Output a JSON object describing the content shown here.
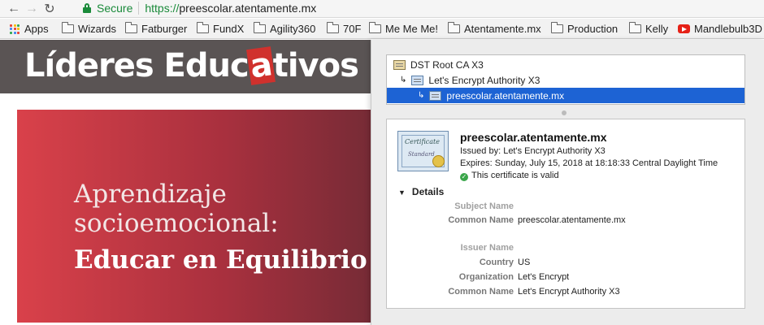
{
  "browser": {
    "secure_label": "Secure",
    "url_scheme": "https://",
    "url_rest": "preescolar.atentamente.mx",
    "bookmarks": [
      {
        "label": "Apps",
        "icon": "apps-grid-icon"
      },
      {
        "label": "Wizards",
        "icon": "folder-icon"
      },
      {
        "label": "Fatburger",
        "icon": "folder-icon"
      },
      {
        "label": "FundX",
        "icon": "folder-icon"
      },
      {
        "label": "Agility360",
        "icon": "folder-icon"
      },
      {
        "label": "70F",
        "icon": "folder-icon"
      },
      {
        "label": "Me Me Me!",
        "icon": "folder-icon"
      },
      {
        "label": "Atentamente.mx",
        "icon": "folder-icon"
      },
      {
        "label": "Production",
        "icon": "folder-icon"
      },
      {
        "label": "Kelly",
        "icon": "folder-icon"
      },
      {
        "label": "Mandlebulb3D",
        "icon": "youtube-icon"
      }
    ]
  },
  "site": {
    "logo_part1": "Líderes Educ",
    "logo_part2": "a",
    "logo_part3": "tivos",
    "hero_line1": "Aprendizaje",
    "hero_line2": "socioemocional:",
    "hero_line3": "Educar en Equilibrio"
  },
  "certificate": {
    "chain": [
      {
        "label": "DST Root CA X3"
      },
      {
        "label": "Let's Encrypt Authority X3"
      },
      {
        "label": "preescolar.atentamente.mx"
      }
    ],
    "badge_text1": "Certificate",
    "badge_text2": "Standard",
    "title": "preescolar.atentamente.mx",
    "issued_by": "Issued by: Let's Encrypt Authority X3",
    "expires": "Expires: Sunday, July 15, 2018 at 18:18:33 Central Daylight Time",
    "valid": "This certificate is valid",
    "details_label": "Details",
    "subject_section": "Subject Name",
    "subject_common_name_label": "Common Name",
    "subject_common_name": "preescolar.atentamente.mx",
    "issuer_section": "Issuer Name",
    "country_label": "Country",
    "country": "US",
    "organization_label": "Organization",
    "organization": "Let's Encrypt",
    "issuer_common_name_label": "Common Name",
    "issuer_common_name": "Let's Encrypt Authority X3"
  },
  "colors": {
    "secure_green": "#1a8a3a",
    "selection_blue": "#1d63d4",
    "hero_red": "#d9414a"
  }
}
